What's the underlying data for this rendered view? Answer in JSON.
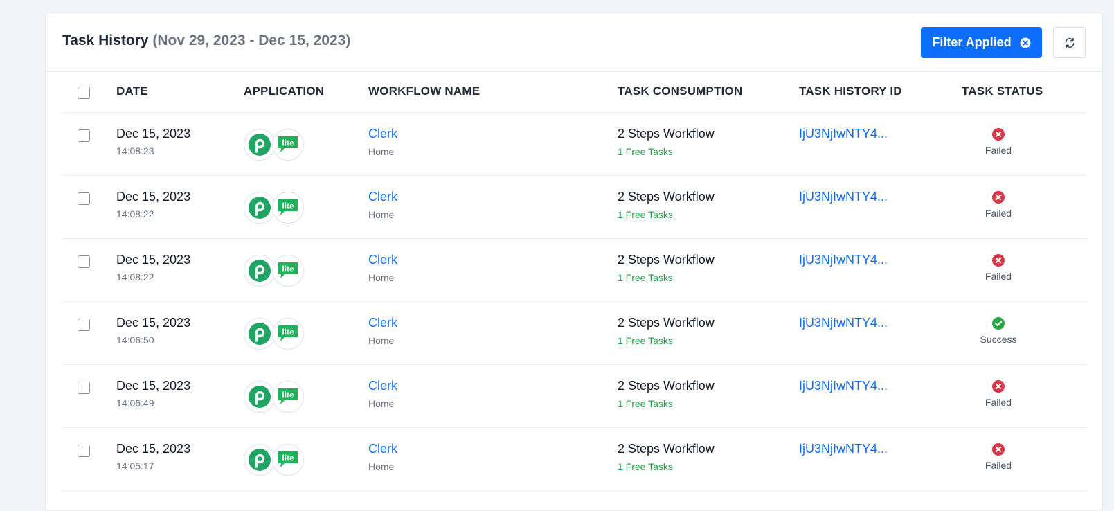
{
  "header": {
    "title": "Task History",
    "date_range": "(Nov 29, 2023 - Dec 15, 2023)",
    "filter_button_label": "Filter Applied"
  },
  "table": {
    "columns": [
      "DATE",
      "APPLICATION",
      "WORKFLOW NAME",
      "TASK CONSUMPTION",
      "TASK HISTORY ID",
      "TASK STATUS"
    ],
    "rows": [
      {
        "date": "Dec 15, 2023",
        "time": "14:08:23",
        "app_badge": "lite",
        "workflow": "Clerk",
        "folder": "Home",
        "consumption": "2 Steps Workflow",
        "free_tasks": "1 Free Tasks",
        "history_id": "IjU3NjIwNTY4...",
        "status": "Failed"
      },
      {
        "date": "Dec 15, 2023",
        "time": "14:08:22",
        "app_badge": "lite",
        "workflow": "Clerk",
        "folder": "Home",
        "consumption": "2 Steps Workflow",
        "free_tasks": "1 Free Tasks",
        "history_id": "IjU3NjIwNTY4...",
        "status": "Failed"
      },
      {
        "date": "Dec 15, 2023",
        "time": "14:08:22",
        "app_badge": "lite",
        "workflow": "Clerk",
        "folder": "Home",
        "consumption": "2 Steps Workflow",
        "free_tasks": "1 Free Tasks",
        "history_id": "IjU3NjIwNTY4...",
        "status": "Failed"
      },
      {
        "date": "Dec 15, 2023",
        "time": "14:06:50",
        "app_badge": "lite",
        "workflow": "Clerk",
        "folder": "Home",
        "consumption": "2 Steps Workflow",
        "free_tasks": "1 Free Tasks",
        "history_id": "IjU3NjIwNTY4...",
        "status": "Success"
      },
      {
        "date": "Dec 15, 2023",
        "time": "14:06:49",
        "app_badge": "lite",
        "workflow": "Clerk",
        "folder": "Home",
        "consumption": "2 Steps Workflow",
        "free_tasks": "1 Free Tasks",
        "history_id": "IjU3NjIwNTY4...",
        "status": "Failed"
      },
      {
        "date": "Dec 15, 2023",
        "time": "14:05:17",
        "app_badge": "lite",
        "workflow": "Clerk",
        "folder": "Home",
        "consumption": "2 Steps Workflow",
        "free_tasks": "1 Free Tasks",
        "history_id": "IjU3NjIwNTY4...",
        "status": "Failed"
      }
    ]
  },
  "colors": {
    "accent": "#0d6efd",
    "failed": "#dc3545",
    "success": "#28a745",
    "brand_green": "#1fa463"
  },
  "icons": {
    "filter_clear": "x-circle-icon",
    "refresh": "refresh-icon",
    "app_primary": "pabbly-p-icon",
    "app_secondary": "lite-chat-icon",
    "failed": "x-circle-icon",
    "success": "check-circle-icon"
  }
}
